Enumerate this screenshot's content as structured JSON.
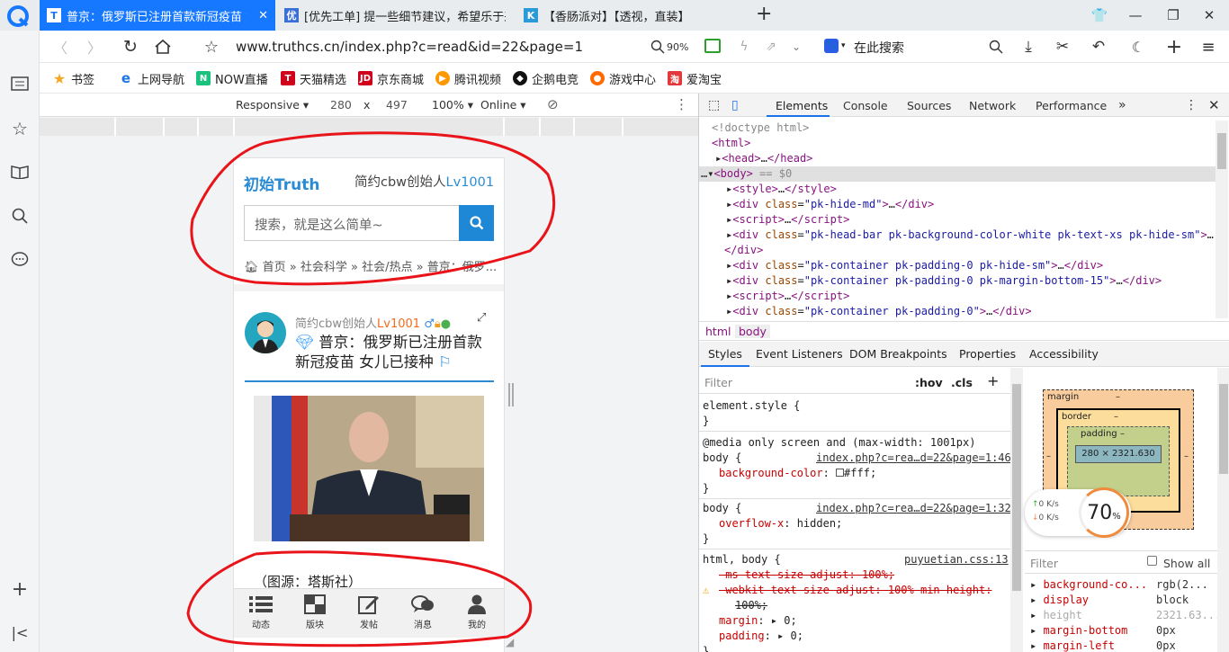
{
  "tabs": [
    {
      "label": "普京：俄罗斯已注册首款新冠疫苗 女儿已接种",
      "icon": "T"
    },
    {
      "label": "[优先工单] 提一些细节建议，希望乐于采纳",
      "icon": "优"
    },
    {
      "label": "【香肠派对】【透视，直装】",
      "icon": "K"
    }
  ],
  "address": {
    "url": "www.truthcs.cn/index.php?c=read&id=22&page=1",
    "zoom": "90%",
    "search_placeholder": "在此搜索"
  },
  "bookmarks": [
    "书签",
    "上网导航",
    "NOW直播",
    "天猫精选",
    "京东商城",
    "腾讯视频",
    "企鹅电竞",
    "游戏中心",
    "爱淘宝"
  ],
  "device_toolbar": {
    "device": "Responsive",
    "width": "280",
    "x": "x",
    "height": "497",
    "zoom": "100%",
    "network": "Online"
  },
  "phone": {
    "site_title": "初始Truth",
    "user_prefix": "简约cbw创始人",
    "user_level": "Lv1001",
    "search_placeholder": "搜索，就是这么简单~",
    "breadcrumb": "首页 » 社会科学 » 社会/热点 » 普京：俄罗...",
    "post_author": "简约cbw创始人",
    "post_level": "Lv1001",
    "post_title": "普京：俄罗斯已注册首款新冠疫苗 女儿已接种",
    "image_caption": "（图源：塔斯社）",
    "nav": [
      "动态",
      "版块",
      "发帖",
      "消息",
      "我的"
    ]
  },
  "devtools": {
    "tabs": [
      "Elements",
      "Console",
      "Sources",
      "Network",
      "Performance"
    ],
    "crumbs": [
      "html",
      "body"
    ],
    "style_tabs": [
      "Styles",
      "Event Listeners",
      "DOM Breakpoints",
      "Properties",
      "Accessibility"
    ],
    "filter_placeholder": "Filter",
    "hov": ":hov",
    "cls": ".cls",
    "box": {
      "margin": "margin",
      "border": "border",
      "padding": "padding",
      "dash": "–",
      "content": "280 × 2321.630"
    },
    "net": {
      "up": "0",
      "down": "0",
      "unit": "K/s",
      "percent": "70",
      "pct_sign": "%"
    },
    "computed_filter": "Filter",
    "show_all": "Show all",
    "computed": [
      {
        "prop": "background-co...",
        "val": "rgb(2..."
      },
      {
        "prop": "display",
        "val": "block"
      },
      {
        "prop": "height",
        "val": "2321.63..."
      },
      {
        "prop": "margin-bottom",
        "val": "0px"
      },
      {
        "prop": "margin-left",
        "val": "0px"
      }
    ],
    "styles": {
      "element_style": "element.style {",
      "media": "@media only screen and (max-width: 1001px)",
      "body_sel": "body {",
      "link1": "index.php?c=rea…d=22&page=1:46",
      "bg_prop": "background-color",
      "bg_val": "#fff;",
      "link2": "index.php?c=rea…d=22&page=1:32",
      "ov_prop": "overflow-x",
      "ov_val": "hidden;",
      "html_body": "html, body {",
      "link3": "puyuetian.css:13",
      "ms_prop": "-ms-text-size-adjust: 100%;",
      "webkit_prop": "-webkit-text-size-adjust: 100% min-height:",
      "webkit_cont": "100%;",
      "margin_decl": "margin",
      "padding_decl": "padding",
      "zero": "0;",
      "close": "}"
    }
  },
  "colors": {
    "accent": "#1677ff",
    "site_blue": "#2a8cd4",
    "level_orange": "#f26b1d",
    "annotation_red": "#e8141a"
  }
}
